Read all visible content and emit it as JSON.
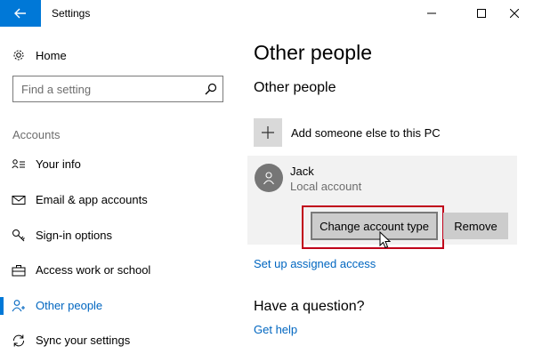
{
  "window": {
    "title": "Settings",
    "controls": [
      "minimize-icon",
      "maximize-icon",
      "close-icon"
    ]
  },
  "sidebar": {
    "home_label": "Home",
    "search_placeholder": "Find a setting",
    "section_header": "Accounts",
    "items": [
      {
        "label": "Your info",
        "icon": "person-card-icon",
        "active": false
      },
      {
        "label": "Email & app accounts",
        "icon": "envelope-icon",
        "active": false
      },
      {
        "label": "Sign-in options",
        "icon": "key-icon",
        "active": false
      },
      {
        "label": "Access work or school",
        "icon": "briefcase-icon",
        "active": false
      },
      {
        "label": "Other people",
        "icon": "people-icon",
        "active": true
      },
      {
        "label": "Sync your settings",
        "icon": "sync-icon",
        "active": false
      }
    ]
  },
  "main": {
    "page_title": "Other people",
    "section_title": "Other people",
    "add_label": "Add someone else to this PC",
    "user": {
      "name": "Jack",
      "type": "Local account"
    },
    "change_button": "Change account type",
    "remove_button": "Remove",
    "assigned_access_link": "Set up assigned access",
    "question_title": "Have a question?",
    "help_link": "Get help"
  },
  "colors": {
    "accent": "#0078d7",
    "link": "#0066c0",
    "highlight": "#c0001a",
    "panel": "#f2f2f2",
    "button": "#cccccc"
  }
}
